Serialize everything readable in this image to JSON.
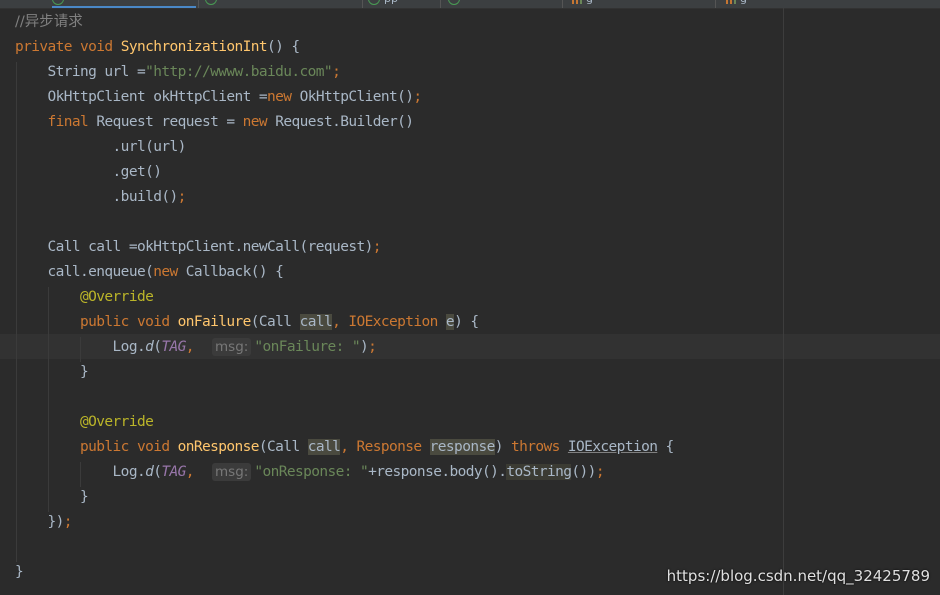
{
  "tabs": [
    {
      "label": "",
      "icon": "java-class-icon"
    },
    {
      "label": "",
      "icon": "android-icon"
    },
    {
      "label": "pp",
      "icon": "circle-icon"
    },
    {
      "label": "",
      "icon": "circle-icon"
    },
    {
      "label": "g",
      "icon": "gradle-icon"
    },
    {
      "label": "g",
      "icon": "gradle-icon"
    }
  ],
  "code": {
    "comment": "//异步请求",
    "l1": {
      "kw": "private void ",
      "fn": "SynchronizationInt",
      "rest": "() {"
    },
    "l2": {
      "a": "    String url =",
      "str": "\"http://wwww.baidu.com\"",
      "semi": ";"
    },
    "l3": {
      "a": "    OkHttpClient okHttpClient =",
      "kw": "new ",
      "b": "OkHttpClient()",
      "semi": ";"
    },
    "l4": {
      "kw1": "    final ",
      "a": "Request request = ",
      "kw2": "new ",
      "b": "Request.Builder()"
    },
    "l5": "            .url(url)",
    "l6": "            .get()",
    "l7": {
      "a": "            .build()",
      "semi": ";"
    },
    "l8": {
      "a": "    Call call =okHttpClient.newCall(request)",
      "semi": ";"
    },
    "l9": {
      "a": "    call.enqueue(",
      "kw": "new ",
      "b": "Callback() {"
    },
    "l10": "        @Override",
    "l11": {
      "kw": "        public void ",
      "fn": "onFailure",
      "a": "(Call ",
      "p1": "call",
      "c": ", IOException ",
      "p2": "e",
      "d": ") {"
    },
    "l12": {
      "a": "            Log.",
      "d": "d",
      "b": "(",
      "tag": "TAG",
      "c": ", ",
      "hint": "msg:",
      "str": "\"onFailure: \"",
      "e": ")",
      "semi": ";"
    },
    "l13": "        }",
    "l14": "        @Override",
    "l15": {
      "kw": "        public void ",
      "fn": "onResponse",
      "a": "(Call ",
      "p1": "call",
      "c": ", Response ",
      "p2": "response",
      "d": ") ",
      "kw2": "throws ",
      "ex": "IOException",
      "e": " {"
    },
    "l16": {
      "a": "            Log.",
      "d": "d",
      "b": "(",
      "tag": "TAG",
      "c": ", ",
      "hint": "msg:",
      "str": "\"onResponse: \"",
      "e": "+response.body().",
      "ts": "toString",
      "f": "())",
      "semi": ";"
    },
    "l17": "        }",
    "l18": {
      "a": "    })",
      "semi": ";"
    },
    "l19": "}"
  },
  "watermark": "https://blog.csdn.net/qq_32425789",
  "colors": {
    "background": "#2b2b2b",
    "keyword": "#cc7832",
    "string": "#6a8759",
    "function": "#ffc66d",
    "annotation": "#bbb529",
    "constant": "#9876aa",
    "comment": "#808080"
  }
}
